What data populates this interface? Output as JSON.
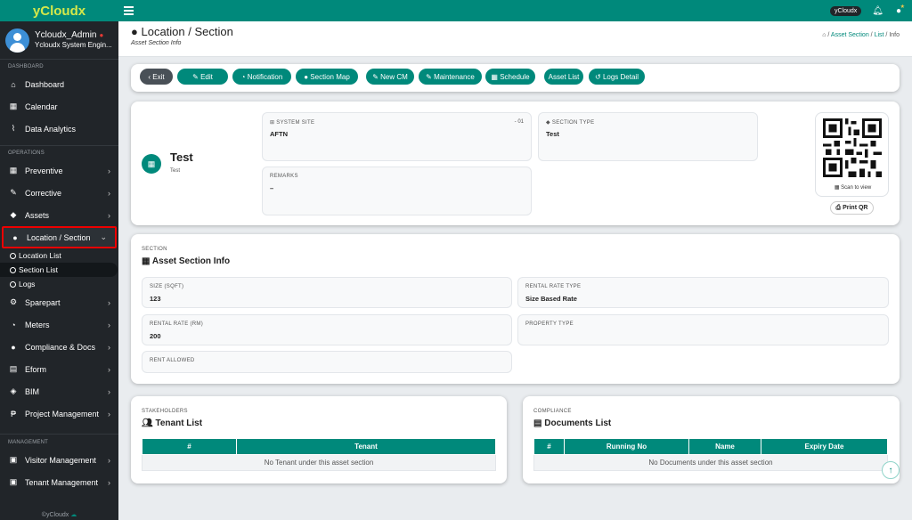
{
  "brand": "yCloudx",
  "user": {
    "name": "Ycloudx_Admin",
    "role": "Ycloudx System Engin..."
  },
  "sidebar": {
    "dashboard_section": "DASHBOARD",
    "operations_section": "OPERATIONS",
    "management_section": "MANAGEMENT",
    "items": {
      "dashboard": "Dashboard",
      "calendar": "Calendar",
      "analytics": "Data Analytics",
      "preventive": "Preventive",
      "corrective": "Corrective",
      "assets": "Assets",
      "location": "Location / Section",
      "location_list": "Location List",
      "section_list": "Section List",
      "logs": "Logs",
      "sparepart": "Sparepart",
      "meters": "Meters",
      "compliance": "Compliance & Docs",
      "eform": "Eform",
      "bim": "BIM",
      "project": "Project Management",
      "visitor": "Visitor Management",
      "tenant": "Tenant Management"
    },
    "footer": "©yCloudx"
  },
  "topbar": {
    "tenant_badge": "yCloudx"
  },
  "header": {
    "title": "Location / Section",
    "subtitle": "Asset Section Info",
    "crumb_section": "Asset Section",
    "crumb_list": "List",
    "crumb_info": "Info"
  },
  "actions": {
    "exit": "Exit",
    "edit": "Edit",
    "notification": "Notification",
    "section_map": "Section Map",
    "new_cm": "New CM",
    "maintenance": "Maintenance",
    "schedule": "Schedule",
    "asset_list": "Asset List",
    "logs_detail": "Logs Detail"
  },
  "summary": {
    "name": "Test",
    "desc": "Test",
    "system_site_label": "SYSTEM SITE",
    "system_site_code": "- 01",
    "system_site_value": "AFTN",
    "section_type_label": "SECTION TYPE",
    "section_type_value": "Test",
    "remarks_label": "REMARKS",
    "remarks_value": "–",
    "scan_label": "Scan to view",
    "print_qr": "Print QR"
  },
  "section_info": {
    "label": "SECTION",
    "title": "Asset Section Info",
    "size_label": "SIZE (SQFT)",
    "size_value": "123",
    "rate_type_label": "RENTAL RATE TYPE",
    "rate_type_value": "Size Based Rate",
    "rate_label": "RENTAL RATE (RM)",
    "rate_value": "200",
    "property_type_label": "PROPERTY TYPE",
    "rent_allowed_label": "RENT ALLOWED"
  },
  "stakeholders": {
    "label": "STAKEHOLDERS",
    "title": "Tenant List",
    "col_no": "#",
    "col_tenant": "Tenant",
    "empty": "No Tenant under this asset section"
  },
  "compliance": {
    "label": "COMPLIANCE",
    "title": "Documents List",
    "col_no": "#",
    "col_running": "Running No",
    "col_name": "Name",
    "col_expiry": "Expiry Date",
    "empty": "No Documents under this asset section"
  },
  "colors": {
    "accent": "#00897b",
    "sidebar": "#212529",
    "highlight": "#e00000"
  }
}
